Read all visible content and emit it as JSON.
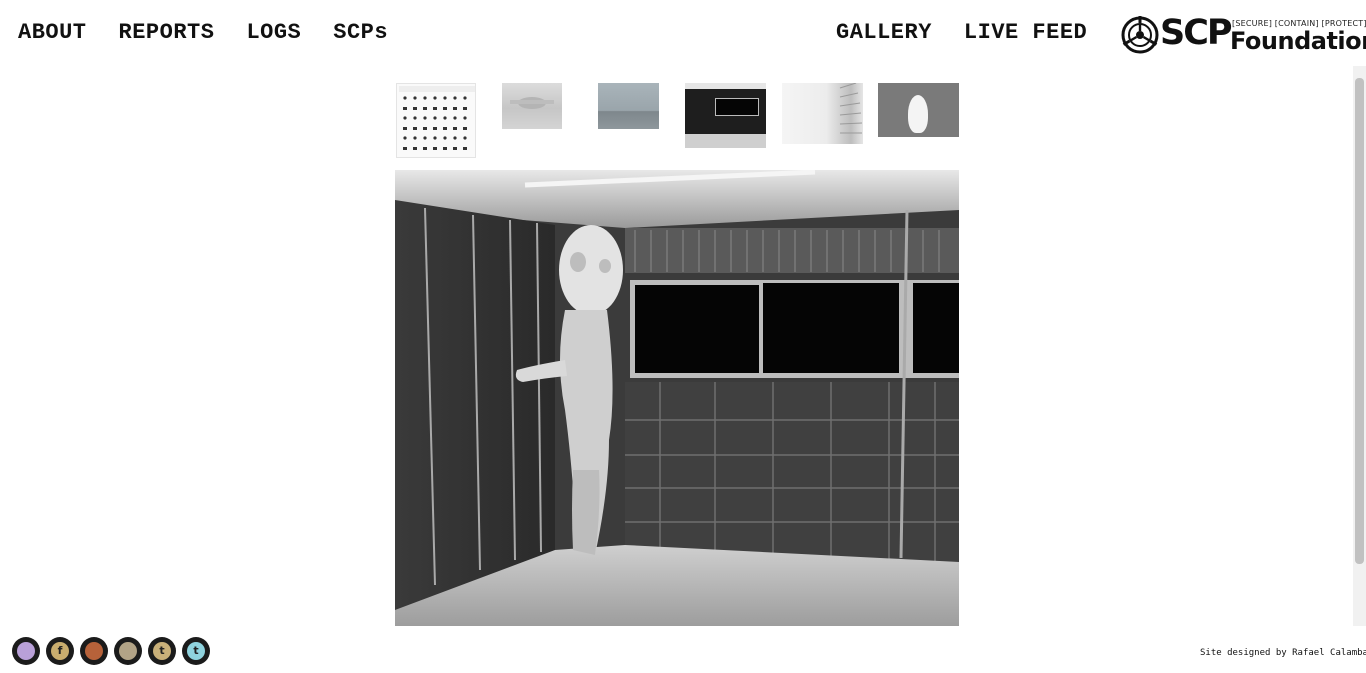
{
  "nav": {
    "left": [
      {
        "label": "ABOUT"
      },
      {
        "label": "REPORTS"
      },
      {
        "label": "LOGS"
      },
      {
        "label": "SCPs"
      }
    ],
    "right": [
      {
        "label": "GALLERY"
      },
      {
        "label": "LIVE FEED"
      }
    ]
  },
  "logo": {
    "wordmark": "SCP",
    "tagline": "[SECURE] [CONTAIN] [PROTECT]",
    "subtitle": "Foundation"
  },
  "gallery": {
    "thumbnails": [
      {
        "icon": "symbols-chart-thumbnail"
      },
      {
        "icon": "faded-logo-thumbnail"
      },
      {
        "icon": "sea-horizon-thumbnail"
      },
      {
        "icon": "containment-room-thumbnail"
      },
      {
        "icon": "bright-corridor-thumbnail"
      },
      {
        "icon": "white-figure-thumbnail"
      }
    ],
    "selected_index": 3,
    "main_image": {
      "icon": "scp-173-containment-room-image"
    }
  },
  "footer": {
    "social": [
      {
        "icon": "wikidot-icon",
        "glyph": "",
        "color": "#b9a0d8"
      },
      {
        "icon": "facebook-icon",
        "glyph": "f",
        "color": "#c9ad6e"
      },
      {
        "icon": "blogger-icon",
        "glyph": "",
        "color": "#b7623a"
      },
      {
        "icon": "steam-icon",
        "glyph": "",
        "color": "#b2a386"
      },
      {
        "icon": "tumblr-icon",
        "glyph": "t",
        "color": "#c9b079"
      },
      {
        "icon": "twitter-icon",
        "glyph": "t",
        "color": "#8fd3de"
      }
    ],
    "credit": "Site designed by Rafael Calamba"
  }
}
